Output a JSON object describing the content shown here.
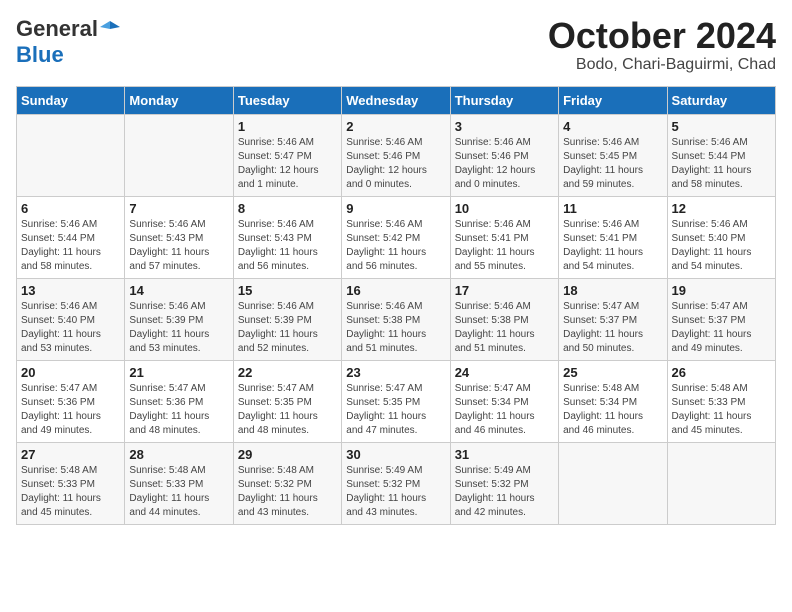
{
  "logo": {
    "general": "General",
    "blue": "Blue"
  },
  "title": {
    "month": "October 2024",
    "location": "Bodo, Chari-Baguirmi, Chad"
  },
  "weekdays": [
    "Sunday",
    "Monday",
    "Tuesday",
    "Wednesday",
    "Thursday",
    "Friday",
    "Saturday"
  ],
  "weeks": [
    [
      {
        "day": "",
        "info": ""
      },
      {
        "day": "",
        "info": ""
      },
      {
        "day": "1",
        "info": "Sunrise: 5:46 AM\nSunset: 5:47 PM\nDaylight: 12 hours\nand 1 minute."
      },
      {
        "day": "2",
        "info": "Sunrise: 5:46 AM\nSunset: 5:46 PM\nDaylight: 12 hours\nand 0 minutes."
      },
      {
        "day": "3",
        "info": "Sunrise: 5:46 AM\nSunset: 5:46 PM\nDaylight: 12 hours\nand 0 minutes."
      },
      {
        "day": "4",
        "info": "Sunrise: 5:46 AM\nSunset: 5:45 PM\nDaylight: 11 hours\nand 59 minutes."
      },
      {
        "day": "5",
        "info": "Sunrise: 5:46 AM\nSunset: 5:44 PM\nDaylight: 11 hours\nand 58 minutes."
      }
    ],
    [
      {
        "day": "6",
        "info": "Sunrise: 5:46 AM\nSunset: 5:44 PM\nDaylight: 11 hours\nand 58 minutes."
      },
      {
        "day": "7",
        "info": "Sunrise: 5:46 AM\nSunset: 5:43 PM\nDaylight: 11 hours\nand 57 minutes."
      },
      {
        "day": "8",
        "info": "Sunrise: 5:46 AM\nSunset: 5:43 PM\nDaylight: 11 hours\nand 56 minutes."
      },
      {
        "day": "9",
        "info": "Sunrise: 5:46 AM\nSunset: 5:42 PM\nDaylight: 11 hours\nand 56 minutes."
      },
      {
        "day": "10",
        "info": "Sunrise: 5:46 AM\nSunset: 5:41 PM\nDaylight: 11 hours\nand 55 minutes."
      },
      {
        "day": "11",
        "info": "Sunrise: 5:46 AM\nSunset: 5:41 PM\nDaylight: 11 hours\nand 54 minutes."
      },
      {
        "day": "12",
        "info": "Sunrise: 5:46 AM\nSunset: 5:40 PM\nDaylight: 11 hours\nand 54 minutes."
      }
    ],
    [
      {
        "day": "13",
        "info": "Sunrise: 5:46 AM\nSunset: 5:40 PM\nDaylight: 11 hours\nand 53 minutes."
      },
      {
        "day": "14",
        "info": "Sunrise: 5:46 AM\nSunset: 5:39 PM\nDaylight: 11 hours\nand 53 minutes."
      },
      {
        "day": "15",
        "info": "Sunrise: 5:46 AM\nSunset: 5:39 PM\nDaylight: 11 hours\nand 52 minutes."
      },
      {
        "day": "16",
        "info": "Sunrise: 5:46 AM\nSunset: 5:38 PM\nDaylight: 11 hours\nand 51 minutes."
      },
      {
        "day": "17",
        "info": "Sunrise: 5:46 AM\nSunset: 5:38 PM\nDaylight: 11 hours\nand 51 minutes."
      },
      {
        "day": "18",
        "info": "Sunrise: 5:47 AM\nSunset: 5:37 PM\nDaylight: 11 hours\nand 50 minutes."
      },
      {
        "day": "19",
        "info": "Sunrise: 5:47 AM\nSunset: 5:37 PM\nDaylight: 11 hours\nand 49 minutes."
      }
    ],
    [
      {
        "day": "20",
        "info": "Sunrise: 5:47 AM\nSunset: 5:36 PM\nDaylight: 11 hours\nand 49 minutes."
      },
      {
        "day": "21",
        "info": "Sunrise: 5:47 AM\nSunset: 5:36 PM\nDaylight: 11 hours\nand 48 minutes."
      },
      {
        "day": "22",
        "info": "Sunrise: 5:47 AM\nSunset: 5:35 PM\nDaylight: 11 hours\nand 48 minutes."
      },
      {
        "day": "23",
        "info": "Sunrise: 5:47 AM\nSunset: 5:35 PM\nDaylight: 11 hours\nand 47 minutes."
      },
      {
        "day": "24",
        "info": "Sunrise: 5:47 AM\nSunset: 5:34 PM\nDaylight: 11 hours\nand 46 minutes."
      },
      {
        "day": "25",
        "info": "Sunrise: 5:48 AM\nSunset: 5:34 PM\nDaylight: 11 hours\nand 46 minutes."
      },
      {
        "day": "26",
        "info": "Sunrise: 5:48 AM\nSunset: 5:33 PM\nDaylight: 11 hours\nand 45 minutes."
      }
    ],
    [
      {
        "day": "27",
        "info": "Sunrise: 5:48 AM\nSunset: 5:33 PM\nDaylight: 11 hours\nand 45 minutes."
      },
      {
        "day": "28",
        "info": "Sunrise: 5:48 AM\nSunset: 5:33 PM\nDaylight: 11 hours\nand 44 minutes."
      },
      {
        "day": "29",
        "info": "Sunrise: 5:48 AM\nSunset: 5:32 PM\nDaylight: 11 hours\nand 43 minutes."
      },
      {
        "day": "30",
        "info": "Sunrise: 5:49 AM\nSunset: 5:32 PM\nDaylight: 11 hours\nand 43 minutes."
      },
      {
        "day": "31",
        "info": "Sunrise: 5:49 AM\nSunset: 5:32 PM\nDaylight: 11 hours\nand 42 minutes."
      },
      {
        "day": "",
        "info": ""
      },
      {
        "day": "",
        "info": ""
      }
    ]
  ]
}
